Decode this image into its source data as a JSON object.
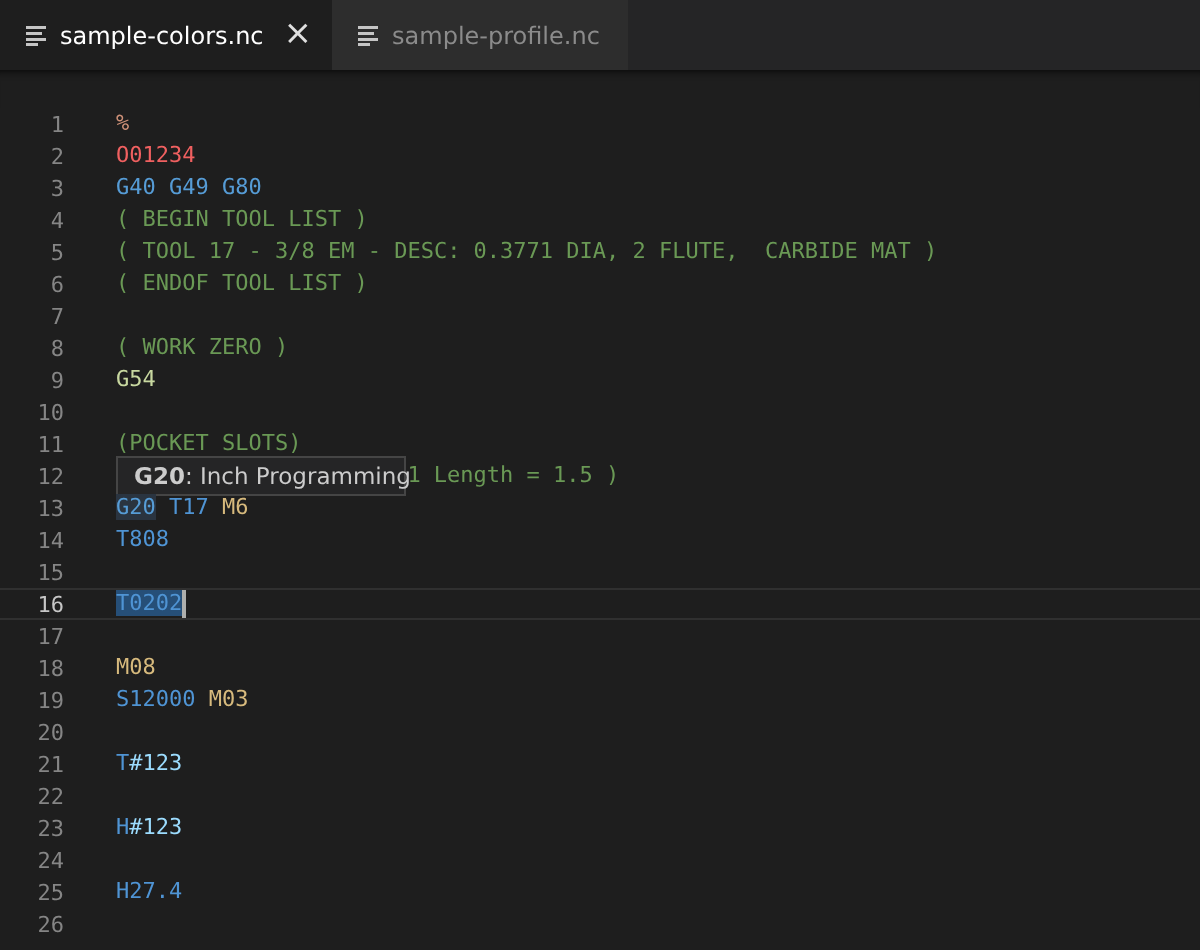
{
  "tabs": [
    {
      "label": "sample-colors.nc",
      "selected": true,
      "close": "×"
    },
    {
      "label": "sample-profile.nc",
      "selected": false
    }
  ],
  "editor": {
    "lines": [
      {
        "number": "1",
        "current": false,
        "tokens": [
          {
            "kind": "percent",
            "text": "%",
            "highlight": false
          }
        ]
      },
      {
        "number": "2",
        "current": false,
        "tokens": [
          {
            "kind": "program",
            "text": "O01234",
            "highlight": false
          }
        ]
      },
      {
        "number": "3",
        "current": false,
        "tokens": [
          {
            "kind": "gcode",
            "text": "G40",
            "highlight": false
          },
          {
            "kind": "gcode",
            "text": "G49",
            "highlight": false
          },
          {
            "kind": "gcode",
            "text": "G80",
            "highlight": false
          }
        ]
      },
      {
        "number": "4",
        "current": false,
        "tokens": [
          {
            "kind": "comment",
            "text": "( BEGIN TOOL LIST )",
            "highlight": false
          }
        ]
      },
      {
        "number": "5",
        "current": false,
        "tokens": [
          {
            "kind": "comment",
            "text": "( TOOL 17 - 3/8 EM - DESC: 0.3771 DIA, 2 FLUTE,  CARBIDE MAT )",
            "highlight": false
          }
        ]
      },
      {
        "number": "6",
        "current": false,
        "tokens": [
          {
            "kind": "comment",
            "text": "( ENDOF TOOL LIST )",
            "highlight": false
          }
        ]
      },
      {
        "number": "7",
        "current": false
      },
      {
        "number": "8",
        "current": false,
        "tokens": [
          {
            "kind": "comment",
            "text": "( WORK ZERO )",
            "highlight": false
          }
        ]
      },
      {
        "number": "9",
        "current": false,
        "tokens": [
          {
            "kind": "work",
            "text": "G54",
            "highlight": false
          }
        ]
      },
      {
        "number": "10",
        "current": false
      },
      {
        "number": "11",
        "current": false,
        "tokens": [
          {
            "kind": "comment",
            "text": "(POCKET SLOTS)",
            "highlight": false
          }
        ]
      },
      {
        "number": "12",
        "current": false,
        "tooltip": {
          "code": "G20",
          "text": ": Inch Programming"
        },
        "tokens": [
          {
            "kind": "comment",
            "text": "1 Length = 1.5 )",
            "highlight": false
          }
        ]
      },
      {
        "number": "13",
        "current": false,
        "tokens": [
          {
            "kind": "gcode",
            "text": "G20",
            "highlight": true
          },
          {
            "kind": "tool",
            "text": "T17",
            "highlight": false
          },
          {
            "kind": "mcode",
            "text": "M6",
            "highlight": false
          }
        ]
      },
      {
        "number": "14",
        "current": false,
        "tokens": [
          {
            "kind": "tool",
            "text": "T808",
            "highlight": false
          }
        ]
      },
      {
        "number": "15",
        "current": false
      },
      {
        "number": "16",
        "current": true,
        "tokens": [
          {
            "kind": "tool",
            "text": "T0202",
            "highlight": true
          }
        ]
      },
      {
        "number": "17",
        "current": false
      },
      {
        "number": "18",
        "current": false,
        "tokens": [
          {
            "kind": "mcode",
            "text": "M08",
            "highlight": false
          }
        ]
      },
      {
        "number": "19",
        "current": false,
        "tokens": [
          {
            "kind": "tool",
            "text": "S12000",
            "highlight": false
          },
          {
            "kind": "mcode",
            "text": "M03",
            "highlight": false
          }
        ]
      },
      {
        "number": "20",
        "current": false
      },
      {
        "number": "21",
        "current": false,
        "tokens": [
          {
            "kind": "tool",
            "text": "T",
            "highlight": false
          },
          {
            "kind": "var",
            "text": "#123",
            "highlight": false
          }
        ]
      },
      {
        "number": "22",
        "current": false
      },
      {
        "number": "23",
        "current": false,
        "tokens": [
          {
            "kind": "tool",
            "text": "H",
            "highlight": false
          },
          {
            "kind": "var",
            "text": "#123",
            "highlight": false
          }
        ]
      },
      {
        "number": "24",
        "current": false
      },
      {
        "number": "25",
        "current": false,
        "tokens": [
          {
            "kind": "tool",
            "text": "H27.4",
            "highlight": false
          }
        ]
      },
      {
        "number": "26",
        "current": false
      }
    ]
  }
}
